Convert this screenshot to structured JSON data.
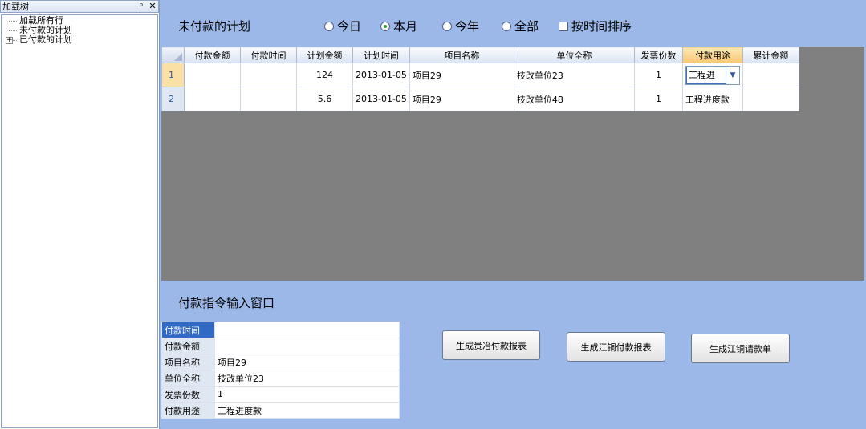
{
  "tree": {
    "title": "加载树",
    "pin": "ᵖ",
    "close": "✕",
    "items": [
      {
        "label": "加载所有行",
        "expander": ""
      },
      {
        "label": "未付款的计划",
        "expander": ""
      },
      {
        "label": "已付款的计划",
        "expander": "+"
      }
    ]
  },
  "unpaid": {
    "title": "未付款的计划",
    "filters": [
      {
        "label": "今日",
        "selected": false
      },
      {
        "label": "本月",
        "selected": true
      },
      {
        "label": "今年",
        "selected": false
      },
      {
        "label": "全部",
        "selected": false
      }
    ],
    "sort_label": "按时间排序"
  },
  "grid": {
    "columns": [
      "付款金额",
      "付款时间",
      "计划金额",
      "计划时间",
      "项目名称",
      "单位全称",
      "发票份数",
      "付款用途",
      "累计金额"
    ],
    "rows": [
      {
        "num": "1",
        "pay_amount": "",
        "pay_time": "",
        "plan_amount": "124",
        "plan_time": "2013-01-05",
        "project": "项目29",
        "unit": "技改单位23",
        "invoices": "1",
        "purpose": "工程进",
        "total": ""
      },
      {
        "num": "2",
        "pay_amount": "",
        "pay_time": "",
        "plan_amount": "5.6",
        "plan_time": "2013-01-05",
        "project": "项目29",
        "unit": "技改单位48",
        "invoices": "1",
        "purpose": "工程进度款",
        "total": ""
      }
    ]
  },
  "instruction": {
    "title": "付款指令输入窗口",
    "fields": [
      {
        "label": "付款时间",
        "value": ""
      },
      {
        "label": "付款金额",
        "value": ""
      },
      {
        "label": "项目名称",
        "value": "项目29"
      },
      {
        "label": "单位全称",
        "value": "技改单位23"
      },
      {
        "label": "发票份数",
        "value": "1"
      },
      {
        "label": "付款用途",
        "value": "工程进度款"
      }
    ],
    "buttons": [
      "生成贵冶付款报表",
      "生成江铜付款报表",
      "生成江铜请款单"
    ]
  }
}
